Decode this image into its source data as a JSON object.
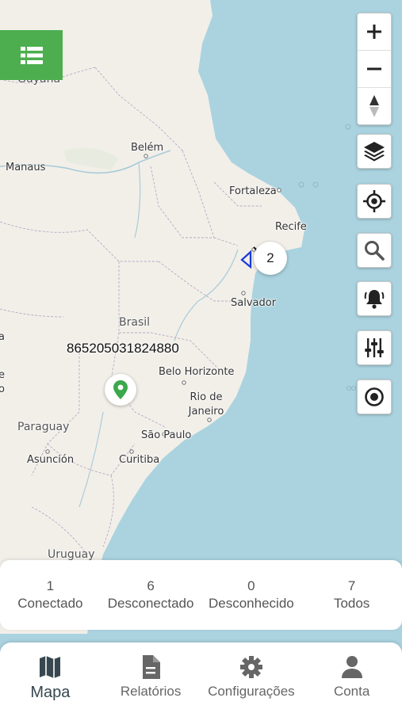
{
  "map": {
    "countries": [
      "Brasil",
      "Guyana",
      "Paraguay",
      "Uruguay"
    ],
    "cities": [
      "Belém",
      "Manaus",
      "Fortaleza",
      "Recife",
      "Salvador",
      "Belo Horizonte",
      "Rio de Janeiro",
      "São Paulo",
      "Curitiba",
      "Asunción"
    ],
    "edge_letters": [
      "a",
      "e",
      "o"
    ],
    "device_label": "865205031824880",
    "cluster_count": "2",
    "marker_color": "#3aa84b"
  },
  "controls": {
    "zoom_in_icon": "plus-icon",
    "zoom_out_icon": "minus-icon",
    "compass_icon": "north-arrow-icon",
    "items": [
      "layers-icon",
      "locate-icon",
      "search-icon",
      "bell-icon",
      "sliders-icon",
      "target-icon"
    ]
  },
  "list_button": {
    "color": "#4cae4f",
    "icon": "list-icon"
  },
  "status": [
    {
      "count": "1",
      "label": "Conectado"
    },
    {
      "count": "6",
      "label": "Desconectado"
    },
    {
      "count": "0",
      "label": "Desconhecido"
    },
    {
      "count": "7",
      "label": "Todos"
    }
  ],
  "nav": [
    {
      "label": "Mapa",
      "icon": "map-icon",
      "active": true
    },
    {
      "label": "Relatórios",
      "icon": "document-icon",
      "active": false
    },
    {
      "label": "Configurações",
      "icon": "gear-icon",
      "active": false
    },
    {
      "label": "Conta",
      "icon": "person-icon",
      "active": false
    }
  ]
}
